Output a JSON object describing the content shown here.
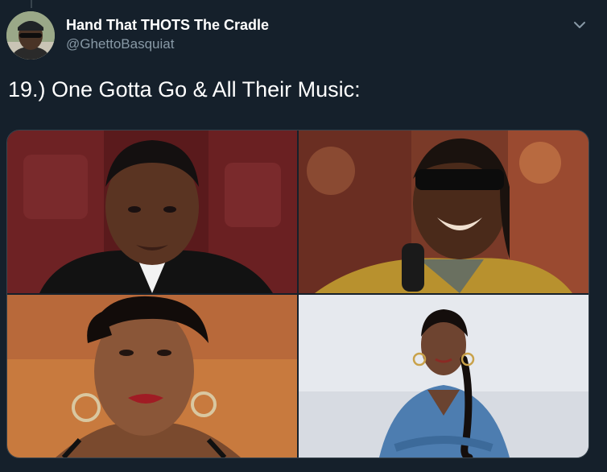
{
  "tweet": {
    "display_name": "Hand That THOTS The Cradle",
    "handle": "@GhettoBasquiat",
    "text": "19.) One Gotta Go & All Their Music:"
  },
  "icons": {
    "caret": "chevron-down-icon"
  },
  "colors": {
    "background": "#15202b",
    "primary_text": "#ffffff",
    "secondary_text": "#8899a6",
    "border": "#38444d"
  }
}
